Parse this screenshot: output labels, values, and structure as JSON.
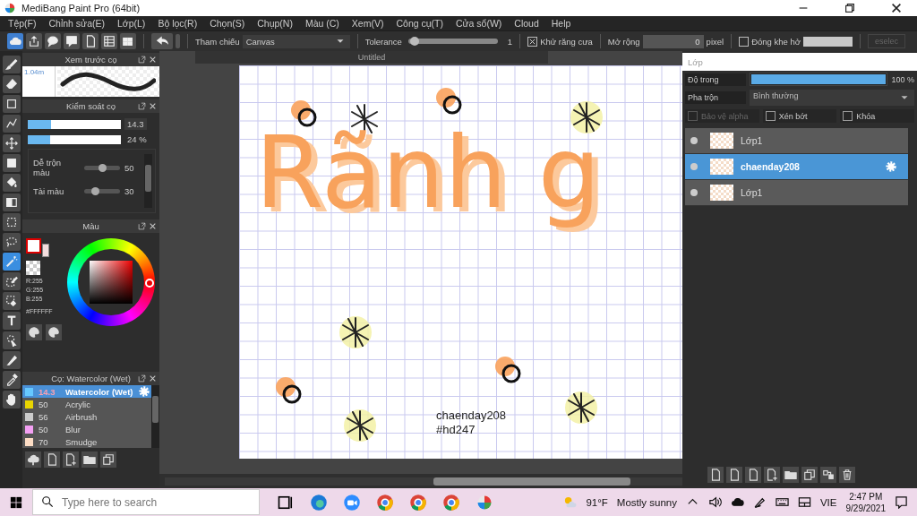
{
  "window": {
    "title": "MediBang Paint Pro (64bit)"
  },
  "menu": [
    "Tệp(F)",
    "Chỉnh sửa(E)",
    "Lớp(L)",
    "Bộ lọc(R)",
    "Chọn(S)",
    "Chụp(N)",
    "Màu (C)",
    "Xem(V)",
    "Công cụ(T)",
    "Cửa sổ(W)",
    "Cloud",
    "Help"
  ],
  "toolbar": {
    "buttons": [
      {
        "kind": "cloud",
        "selected": true
      },
      {
        "kind": "share",
        "selected": false
      },
      {
        "kind": "speech",
        "selected": false
      },
      {
        "kind": "comment",
        "selected": false
      },
      {
        "kind": "page",
        "selected": false
      },
      {
        "kind": "list",
        "selected": false
      },
      {
        "kind": "grid",
        "selected": false
      }
    ],
    "reference": {
      "label": "Tham chiếu",
      "value": "Canvas"
    },
    "tolerance": {
      "label": "Tolerance",
      "level": 0.02,
      "value": "1"
    },
    "antialias": {
      "label": "Khử răng cưa",
      "checked": true
    },
    "expand": {
      "label": "Mở rộng",
      "value": "0",
      "unit": "pixel"
    },
    "close_gap": {
      "label": "Đóng khe hở",
      "checked": false
    },
    "deselect": {
      "label": "eselec",
      "disabled": true
    }
  },
  "tools": [
    {
      "kind": "brush",
      "selected": false
    },
    {
      "kind": "eraser",
      "selected": false
    },
    {
      "kind": "square",
      "selected": false
    },
    {
      "kind": "check",
      "selected": false
    },
    {
      "kind": "move",
      "selected": false
    },
    {
      "kind": "fill",
      "selected": false
    },
    {
      "kind": "bucket",
      "selected": false
    },
    {
      "kind": "gradient",
      "selected": false
    },
    {
      "kind": "dotsquare",
      "selected": false
    },
    {
      "kind": "lasso",
      "selected": false
    },
    {
      "kind": "wand",
      "selected": true
    },
    {
      "kind": "penselect",
      "selected": false
    },
    {
      "kind": "erasersel",
      "selected": false
    },
    {
      "kind": "text",
      "selected": false
    },
    {
      "kind": "pointer",
      "selected": false
    },
    {
      "kind": "knife",
      "selected": false
    },
    {
      "kind": "dropper",
      "selected": false
    },
    {
      "kind": "hand",
      "selected": false
    }
  ],
  "brush_preview": {
    "title": "Xem trước cọ",
    "size": "1.04m"
  },
  "brush_control": {
    "title": "Kiểm soát cọ",
    "sliders": [
      {
        "kind": "boxed",
        "level": 0.25,
        "value": "14.3"
      },
      {
        "kind": "plain",
        "level": 0.24,
        "value": "24 %"
      }
    ],
    "mix": [
      {
        "label": "Dễ trộn màu",
        "level": 0.5,
        "value": "50"
      },
      {
        "label": "Tài màu",
        "level": 0.3,
        "value": "30"
      }
    ]
  },
  "color": {
    "title": "Màu",
    "rgb": [
      "R:255",
      "G:255",
      "B:255"
    ],
    "hex": "#FFFFFF"
  },
  "brushes": {
    "title": "Cọ: Watercolor (Wet)",
    "items": [
      {
        "size": "14.3",
        "name": "Watercolor (Wet)",
        "color": "#66c8ff",
        "selected": true
      },
      {
        "size": "50",
        "name": "Acrylic",
        "color": "#e8d400",
        "selected": false
      },
      {
        "size": "56",
        "name": "Airbrush",
        "color": "#cccccc",
        "selected": false
      },
      {
        "size": "50",
        "name": "Blur",
        "color": "#f4a0f4",
        "selected": false
      },
      {
        "size": "70",
        "name": "Smudge",
        "color": "#fcdcc4",
        "selected": false
      }
    ]
  },
  "document": {
    "tab": "Untitled",
    "lettering": "Rãnh g",
    "caption": [
      "chaenday208",
      "#hd247"
    ]
  },
  "layers": {
    "title": "Lớp",
    "opacity": {
      "label": "Độ trong",
      "level": 1,
      "value": "100 %"
    },
    "blend": {
      "label": "Pha trộn",
      "value": "Bình thường"
    },
    "options": [
      {
        "label": "Bảo vệ alpha",
        "checked": false,
        "disabled": true
      },
      {
        "label": "Xén bớt",
        "checked": false,
        "disabled": false
      },
      {
        "label": "Khóa",
        "checked": false,
        "disabled": false
      }
    ],
    "items": [
      {
        "name": "Lớp1",
        "selected": false
      },
      {
        "name": "chaenday208",
        "selected": true
      },
      {
        "name": "Lớp1",
        "selected": false
      }
    ]
  },
  "taskbar": {
    "search": {
      "placeholder": "Type here to search"
    },
    "weather": {
      "temp": "91°F",
      "text": "Mostly sunny"
    },
    "language": "VIE",
    "time": "2:47 PM",
    "date": "9/29/2021"
  }
}
